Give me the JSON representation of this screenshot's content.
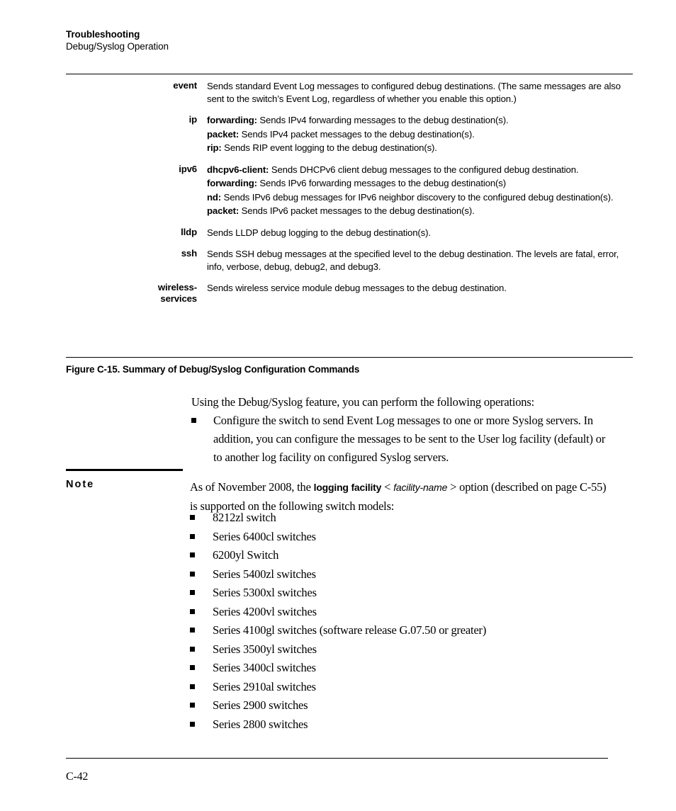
{
  "header": {
    "title": "Troubleshooting",
    "subtitle": "Debug/Syslog Operation"
  },
  "command_table": {
    "rows": [
      {
        "label": "event",
        "lines": [
          {
            "term": "",
            "text": "Sends standard Event Log messages to configured debug destinations. (The same messages are also sent to the switch’s Event Log, regardless of whether you enable this option.)"
          }
        ]
      },
      {
        "label": "ip",
        "lines": [
          {
            "term": "forwarding:",
            "text": "Sends IPv4 forwarding messages to the debug destination(s)."
          },
          {
            "term": "packet:",
            "text": "Sends IPv4 packet messages to the debug destination(s)."
          },
          {
            "term": "rip:",
            "text": "Sends RIP event logging to the debug destination(s)."
          }
        ]
      },
      {
        "label": "ipv6",
        "lines": [
          {
            "term": "dhcpv6-client:",
            "text": "Sends DHCPv6 client debug messages to the configured debug destination."
          },
          {
            "term": "forwarding:",
            "text": "Sends IPv6 forwarding messages to the debug destination(s)"
          },
          {
            "term": "nd:",
            "text": "Sends IPv6 debug messages for IPv6 neighbor discovery to the configured debug destination(s)."
          },
          {
            "term": "packet:",
            "text": "Sends IPv6 packet messages to the debug destination(s)."
          }
        ]
      },
      {
        "label": "lldp",
        "lines": [
          {
            "term": "",
            "text": "Sends LLDP debug logging to the debug destination(s)."
          }
        ]
      },
      {
        "label": "ssh",
        "lines": [
          {
            "term": "",
            "text": "Sends SSH debug messages at the specified level to the debug destination. The levels are fatal, error, info, verbose, debug, debug2, and debug3."
          }
        ]
      },
      {
        "label": "wireless-\nservices",
        "lines": [
          {
            "term": "",
            "text": "Sends wireless service module debug messages to the debug destination."
          }
        ]
      }
    ]
  },
  "figure": {
    "caption": "Figure C-15. Summary of Debug/Syslog Configuration Commands"
  },
  "intro": {
    "lead": "Using the Debug/Syslog feature, you can perform the following operations:",
    "bullets": [
      "Configure the switch to send Event Log messages to one or more Syslog servers. In addition, you can configure the messages to be sent to the User log facility (default) or to another log facility on configured Syslog servers."
    ]
  },
  "note": {
    "label": "Note",
    "body_prefix": "As of November 2008, the ",
    "body_bold": "logging facility",
    "body_lt": " < ",
    "body_italic": "facility-name",
    "body_gt": " > ",
    "body_suffix": "option (described on page C-55) is supported on the following switch models:",
    "bullets": [
      "8212zl switch",
      "Series 6400cl switches",
      "6200yl Switch",
      "Series 5400zl switches",
      "Series 5300xl switches",
      "Series 4200vl switches",
      "Series 4100gl switches (software release G.07.50 or greater)",
      "Series 3500yl switches",
      "Series 3400cl switches",
      "Series 2910al switches",
      "Series 2900 switches",
      "Series 2800 switches"
    ]
  },
  "footer": {
    "page_number": "C-42"
  }
}
